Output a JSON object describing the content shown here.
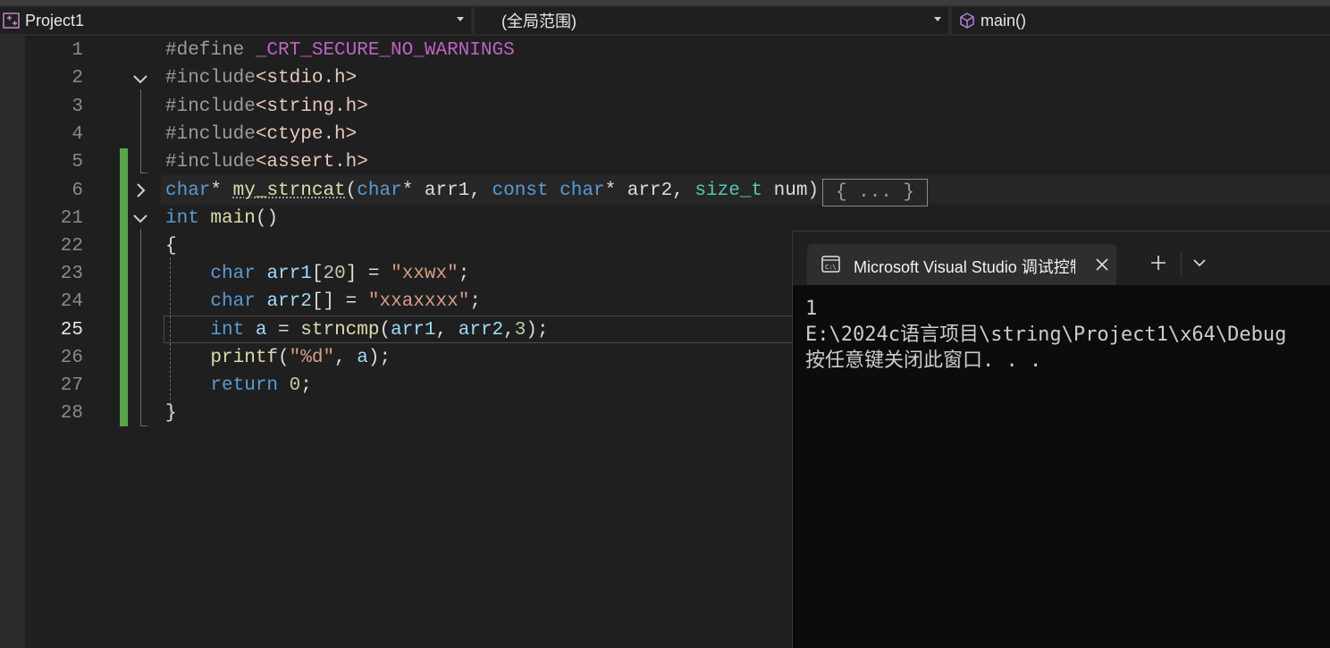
{
  "navbar": {
    "project": "Project1",
    "scope": "(全局范围)",
    "function": "main()"
  },
  "editor": {
    "line_numbers": [
      "1",
      "2",
      "3",
      "4",
      "5",
      "6",
      "21",
      "22",
      "23",
      "24",
      "25",
      "26",
      "27",
      "28"
    ],
    "active_line": "25",
    "collapsed_placeholder": "{ ... }",
    "lines": {
      "l1": {
        "directive": "#define",
        "macro": "_CRT_SECURE_NO_WARNINGS"
      },
      "l2": {
        "directive": "#include",
        "header": "<stdio.h>"
      },
      "l3": {
        "directive": "#include",
        "header": "<string.h>"
      },
      "l4": {
        "directive": "#include",
        "header": "<ctype.h>"
      },
      "l5": {
        "directive": "#include",
        "header": "<assert.h>"
      },
      "l6": {
        "t1": "char",
        "t2": "* ",
        "fn": "my_strncat",
        "t3": "(",
        "t4": "char",
        "t5": "* arr1, ",
        "t6": "const",
        "t7": " ",
        "t8": "char",
        "t9": "* arr2, ",
        "t10": "size_t",
        "t11": " num)"
      },
      "l21": {
        "kw": "int",
        "fn": "main",
        "rest": "()"
      },
      "l22": {
        "text": "{"
      },
      "l23": {
        "kw": "char",
        "var": "arr1",
        "p1": "[",
        "num": "20",
        "p2": "] = ",
        "str": "\"xxwx\"",
        "p3": ";"
      },
      "l24": {
        "kw": "char",
        "var": "arr2",
        "p1": "[] = ",
        "str": "\"xxaxxxx\"",
        "p2": ";"
      },
      "l25": {
        "kw": "int",
        "var": "a",
        "p1": " = ",
        "fn": "strncmp",
        "p2": "(",
        "v1": "arr1",
        "p3": ", ",
        "v2": "arr2",
        "p4": ",",
        "num": "3",
        "p5": ");"
      },
      "l26": {
        "fn": "printf",
        "p1": "(",
        "str": "\"%d\"",
        "p2": ", ",
        "var": "a",
        "p3": ");"
      },
      "l27": {
        "kw": "return",
        "num": "0",
        "p1": ";"
      },
      "l28": {
        "text": "}"
      }
    }
  },
  "terminal": {
    "tab_title": "Microsoft Visual Studio 调试控制台",
    "output": [
      "1",
      "E:\\2024c语言项目\\string\\Project1\\x64\\Debug",
      "按任意键关闭此窗口. . ."
    ]
  },
  "colors": {
    "keyword": "#569cd6",
    "function": "#dcdcaa",
    "string": "#d69d85",
    "change_bar": "#57a64a"
  }
}
